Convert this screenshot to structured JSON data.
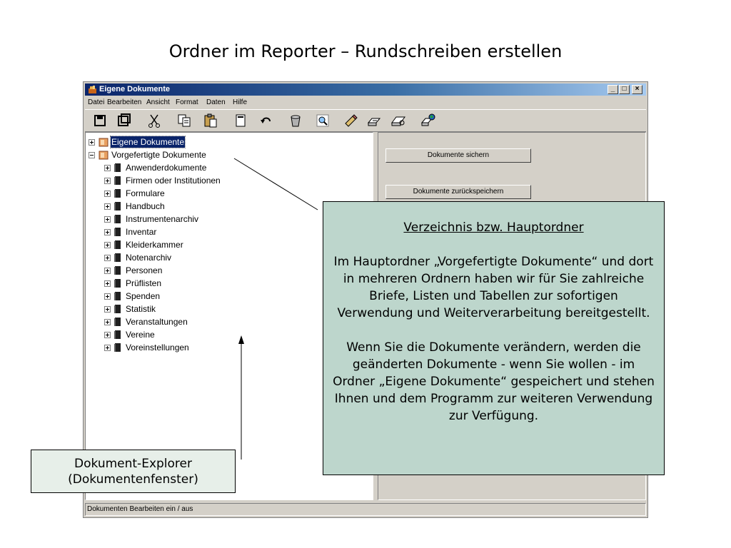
{
  "slide": {
    "title": "Ordner im Reporter – Rundschreiben erstellen"
  },
  "window": {
    "title": "Eigene Dokumente",
    "controls": {
      "minimize": "_",
      "maximize": "□",
      "close": "×"
    },
    "menu": [
      "Datei",
      "Bearbeiten",
      "Ansicht",
      "Format",
      "Daten",
      "Hilfe"
    ],
    "toolbar_icons": [
      "save-icon",
      "save-all-icon",
      "cut-icon",
      "copy-icon",
      "paste-icon",
      "new-document-icon",
      "undo-icon",
      "delete-icon",
      "search-icon",
      "edit-icon",
      "print-icon",
      "print-preview-icon",
      "send-icon"
    ]
  },
  "tree": {
    "roots": [
      {
        "label": "Eigene Dokumente",
        "expanded": false,
        "selected": true
      },
      {
        "label": "Vorgefertigte Dokumente",
        "expanded": true,
        "selected": false
      }
    ],
    "children": [
      "Anwenderdokumente",
      "Firmen oder Institutionen",
      "Formulare",
      "Handbuch",
      "Instrumentenarchiv",
      "Inventar",
      "Kleiderkammer",
      "Notenarchiv",
      "Personen",
      "Prüflisten",
      "Spenden",
      "Statistik",
      "Veranstaltungen",
      "Vereine",
      "Voreinstellungen"
    ]
  },
  "right_panel": {
    "buttons": [
      {
        "label": "Dokumente sichern"
      },
      {
        "label": "Dokumente zurückspeichern"
      }
    ]
  },
  "status_bar": {
    "text": "Dokumenten Bearbeiten ein / aus"
  },
  "callout": {
    "heading": "Verzeichnis bzw. Hauptordner",
    "paragraph1": "Im Hauptordner „Vorgefertigte Dokumente“ und dort in mehreren Ordnern haben wir für Sie zahlreiche Briefe, Listen und Tabellen zur sofortigen Verwendung und Weiterverarbeitung bereitgestellt.",
    "paragraph2": "Wenn Sie die Dokumente verändern, werden die geänderten Dokumente - wenn Sie wollen - im Ordner „Eigene Dokumente“ gespeichert und stehen Ihnen und dem Programm zur weiteren Verwendung zur Verfügung."
  },
  "label": {
    "line1": "Dokument-Explorer",
    "line2": "(Dokumentenfenster)"
  },
  "colors": {
    "title_bar_start": "#0a246a",
    "title_bar_end": "#a6caf0",
    "callout_bg": "#bdd6cc",
    "label_bg": "#e7efe9",
    "window_bg": "#d4d0c8",
    "selection": "#0a246a"
  }
}
